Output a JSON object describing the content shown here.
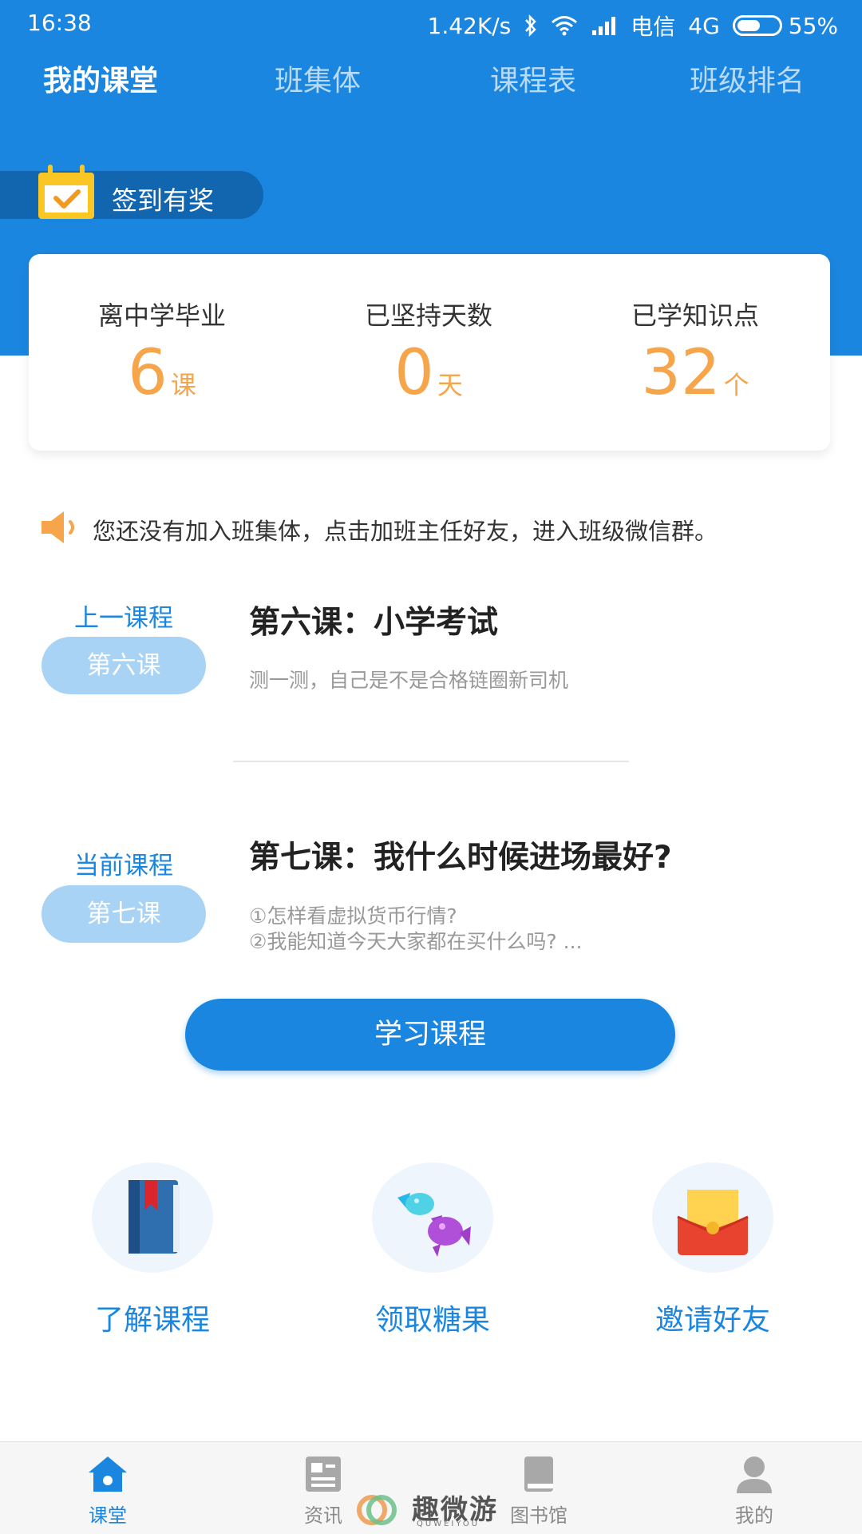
{
  "status_bar": {
    "time": "16:38",
    "network_speed": "1.42K/s",
    "carrier": "电信",
    "network_type": "4G",
    "battery_percent": "55%",
    "battery_level": 0.55
  },
  "top_tabs": [
    {
      "label": "我的课堂",
      "active": true
    },
    {
      "label": "班集体",
      "active": false
    },
    {
      "label": "课程表",
      "active": false
    },
    {
      "label": "班级排名",
      "active": false
    }
  ],
  "checkin": {
    "label": "签到有奖",
    "icon": "calendar-check-icon"
  },
  "stats": [
    {
      "label": "离中学毕业",
      "value": "6",
      "unit": "课"
    },
    {
      "label": "已坚持天数",
      "value": "0",
      "unit": "天"
    },
    {
      "label": "已学知识点",
      "value": "32",
      "unit": "个"
    }
  ],
  "notice": {
    "icon": "speaker-icon",
    "text": "您还没有加入班集体，点击加班主任好友，进入班级微信群。"
  },
  "previous_course": {
    "tag": "上一课程",
    "pill": "第六课",
    "title": "第六课：小学考试",
    "desc_lines": [
      "测一测，自己是不是合格链圈新司机"
    ]
  },
  "current_course": {
    "tag": "当前课程",
    "pill": "第七课",
    "title": "第七课：我什么时候进场最好?",
    "desc_lines": [
      "①怎样看虚拟货币行情?",
      "②我能知道今天大家都在买什么吗? ..."
    ]
  },
  "study_button": "学习课程",
  "features": [
    {
      "label": "了解课程",
      "icon": "book-icon"
    },
    {
      "label": "领取糖果",
      "icon": "candy-icon"
    },
    {
      "label": "邀请好友",
      "icon": "red-envelope-icon"
    }
  ],
  "bottom_nav": [
    {
      "label": "课堂",
      "icon": "home-icon",
      "active": true
    },
    {
      "label": "资讯",
      "icon": "news-icon",
      "active": false
    },
    {
      "label": "图书馆",
      "icon": "library-icon",
      "active": false
    },
    {
      "label": "我的",
      "icon": "profile-icon",
      "active": false
    }
  ],
  "watermark": {
    "text": "趣微游",
    "sub": "QUWEIYOU"
  },
  "colors": {
    "primary": "#1b86df",
    "accent_orange": "#f7a54a",
    "pill_light_blue": "#a9d3f5"
  }
}
